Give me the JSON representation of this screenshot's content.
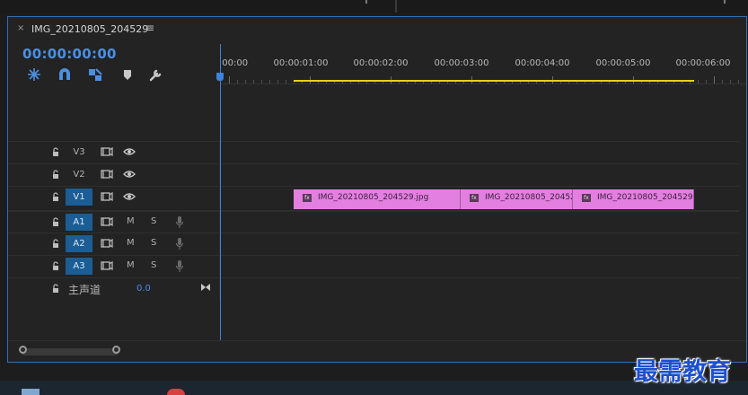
{
  "sequence": {
    "title": "IMG_20210805_204529",
    "close_glyph": "×",
    "menu_glyph": "≡",
    "timecode": "00:00:00:00"
  },
  "tools": [
    "snap-icon",
    "magnet-icon",
    "linked-selection-icon",
    "marker-icon",
    "wrench-icon"
  ],
  "ruler": {
    "labels": [
      ":00:00",
      "00:00:01:00",
      "00:00:02:00",
      "00:00:03:00",
      "00:00:04:00",
      "00:00:05:00",
      "00:00:06:00"
    ]
  },
  "tracks": {
    "v3": "V3",
    "v2": "V2",
    "v1": "V1",
    "a1": "A1",
    "a2": "A2",
    "a3": "A3",
    "mute": "M",
    "solo": "S",
    "master": "主声道",
    "master_volume": "0.0"
  },
  "clips": [
    {
      "fx": "fx",
      "name": "IMG_20210805_204529.jpg"
    },
    {
      "fx": "fx",
      "name": "IMG_20210805_20452"
    },
    {
      "fx": "fx",
      "name": "IMG_20210805_204529.j"
    }
  ],
  "watermark": "最需教育",
  "colors": {
    "accent": "#4a8fe3",
    "clip": "#e37fe0",
    "workarea": "#e6d313",
    "track_target": "#1b5d95"
  }
}
